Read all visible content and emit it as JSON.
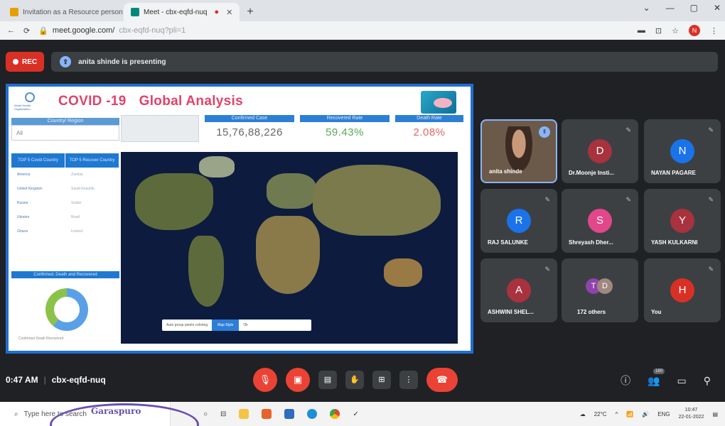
{
  "browser": {
    "tabs": [
      {
        "title": "Invitation as a Resource person",
        "fav_color": "#e5a000",
        "active": false
      },
      {
        "title": "Meet - cbx-eqfd-nuq",
        "fav_color": "#00897b",
        "active": true
      }
    ],
    "new_tab": "+",
    "window_controls": [
      "⌄",
      "—",
      "▢",
      "✕"
    ],
    "url_domain": "meet.google.com/",
    "url_path": "cbx-eqfd-nuq?pli=1",
    "profile_initial": "N"
  },
  "meet": {
    "rec_label": "REC",
    "presenting_text": "anita shinde is presenting",
    "meeting_time": "0:47 AM",
    "meeting_code": "cbx-eqfd-nuq",
    "participants_badge": "180",
    "participants": [
      {
        "name": "anita shinde",
        "type": "video"
      },
      {
        "name": "Dr.Moonje Insti...",
        "initial": "D",
        "color": "#a8323e"
      },
      {
        "name": "NAYAN PAGARE",
        "initial": "N",
        "color": "#1a73e8"
      },
      {
        "name": "RAJ SALUNKE",
        "initial": "R",
        "color": "#1a73e8"
      },
      {
        "name": "Shreyash Dher...",
        "initial": "S",
        "color": "#e2478b"
      },
      {
        "name": "YASH KULKARNI",
        "initial": "Y",
        "color": "#a8323e"
      },
      {
        "name": "ASHWINI SHEL...",
        "initial": "A",
        "color": "#a8323e"
      },
      {
        "name": "172 others",
        "type": "others",
        "initials": [
          "T",
          "D"
        ],
        "colors": [
          "#8e44ad",
          "#a1887f"
        ]
      },
      {
        "name": "You",
        "initial": "H",
        "color": "#d93025"
      }
    ]
  },
  "dashboard": {
    "logo_text": "World Health Organization",
    "title_part1": "COVID -19",
    "title_part2": "Global Analysis",
    "country_region_label": "Country/ Region",
    "country_value": "All",
    "top5_confirmed_header": "TOP 5 Covid Country",
    "top5_recover_header": "TOP 5 Recover Country",
    "top5_confirmed": [
      "America",
      "United Kingdom",
      "Russia",
      "Ukraine",
      "Ghana"
    ],
    "top5_recover": [
      "Zambia",
      "Saudi Republic",
      "Sudan",
      "Brazil",
      "Iceland"
    ],
    "donut_header": "Confirmed, Death and Recovered",
    "donut_legend": "Confirmed  Death  Recovered",
    "kpis": [
      {
        "label": "Confirmed Case",
        "value": "15,76,88,226",
        "color": "#666666"
      },
      {
        "label": "Recovered Rate",
        "value": "59.43%",
        "color": "#5aa85a"
      },
      {
        "label": "Death Rate",
        "value": "2.08%",
        "color": "#e06666"
      }
    ],
    "map_control_text": "Auto group points coloring",
    "map_control_button": "Map Style",
    "map_control_end": "Ok"
  },
  "taskbar": {
    "search_placeholder": "Type here to search",
    "stamp_text": "Garaspuro",
    "weather": "22°C",
    "lang": "ENG",
    "time": "10:47",
    "date": "22-01-2022"
  }
}
